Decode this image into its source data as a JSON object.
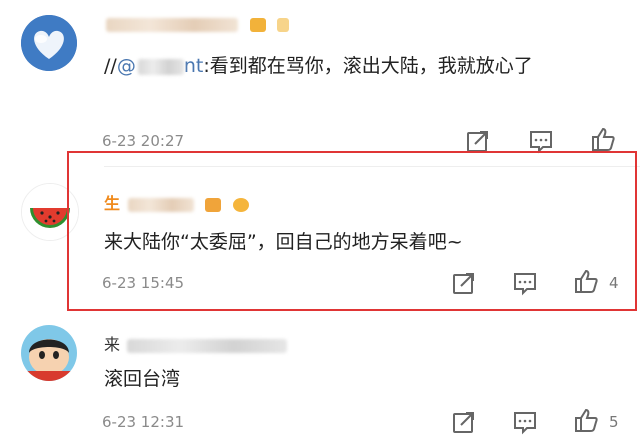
{
  "comments": [
    {
      "username_visible": "",
      "text_prefix": "//",
      "mention": "@",
      "mention_tail": "nt",
      "text": ":看到都在骂你，滚出大陆，我就放心了",
      "time": "6-23 20:27",
      "like_count": ""
    },
    {
      "username_visible": "生",
      "text": "来大陆你“太委屈”，回自己的地方呆着吧~",
      "time": "6-23 15:45",
      "like_count": "4"
    },
    {
      "username_visible": "来",
      "text": "滚回台湾",
      "time": "6-23 12:31",
      "like_count": "5"
    }
  ],
  "icons": {
    "share": "share-icon",
    "comment": "comment-icon",
    "like": "thumbs-up-icon"
  },
  "colors": {
    "username": "#f08a1c",
    "highlight": "#e03535",
    "time": "#8a8a8a",
    "mention": "#4a77b0"
  }
}
